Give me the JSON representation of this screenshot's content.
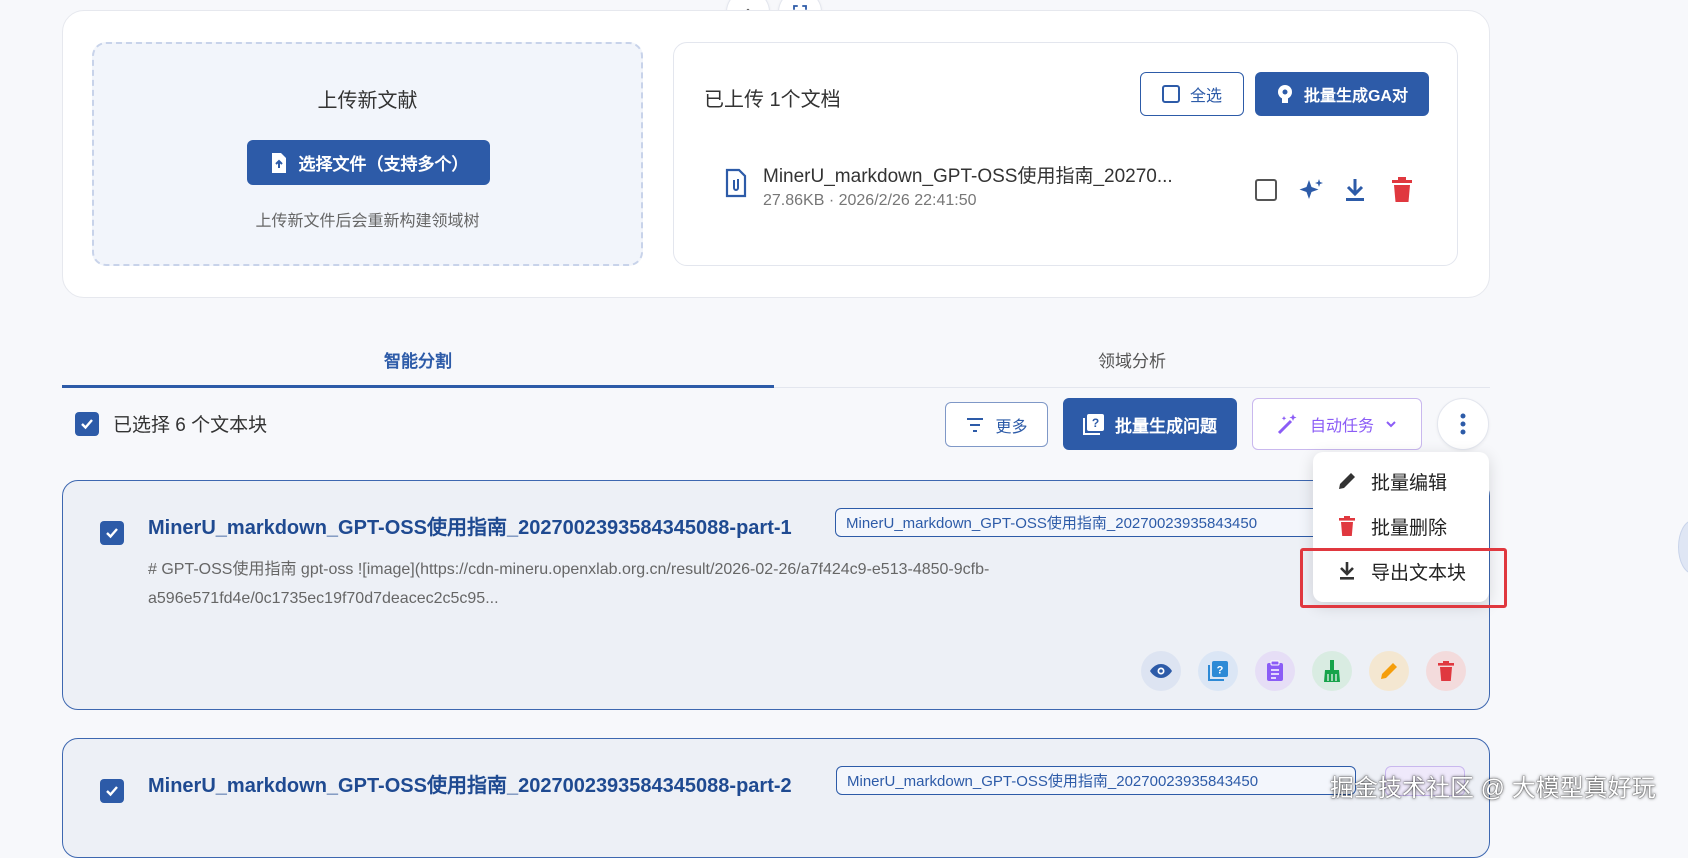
{
  "upload": {
    "title": "上传新文献",
    "choose_button": "选择文件（支持多个）",
    "hint": "上传新文件后会重新构建领域树"
  },
  "documents": {
    "title": "已上传 1个文档",
    "select_all": "全选",
    "batch_ga": "批量生成GA对",
    "items": [
      {
        "name": "MinerU_markdown_GPT-OSS使用指南_20270...",
        "meta": "27.86KB · 2026/2/26 22:41:50"
      }
    ]
  },
  "tabs": [
    {
      "label": "智能分割",
      "active": true
    },
    {
      "label": "领域分析",
      "active": false
    }
  ],
  "toolbar": {
    "selected_text": "已选择 6 个文本块",
    "more": "更多",
    "batch_questions": "批量生成问题",
    "auto_tasks": "自动任务"
  },
  "menu": {
    "items": [
      {
        "label": "批量编辑",
        "icon": "pencil-icon"
      },
      {
        "label": "批量删除",
        "icon": "trash-icon"
      },
      {
        "label": "导出文本块",
        "icon": "download-icon"
      }
    ]
  },
  "chunks": [
    {
      "title": "MinerU_markdown_GPT-OSS使用指南_2027002393584345088-part-1",
      "tag": "MinerU_markdown_GPT-OSS使用指南_20270023935843450",
      "line1": "# GPT-OSS使用指南 gpt-oss ![image](https://cdn-mineru.openxlab.org.cn/result/2026-02-26/a7f424c9-e513-4850-9cfb-",
      "line2": "a596e571fd4e/0c1735ec19f70d7deacec2c5c95..."
    },
    {
      "title": "MinerU_markdown_GPT-OSS使用指南_2027002393584345088-part-2",
      "tag": "MinerU_markdown_GPT-OSS使用指南_20270023935843450"
    }
  ],
  "watermark": "掘金技术社区 @ 大模型真好玩",
  "colors": {
    "primary": "#2d5ba8",
    "danger": "#e0383f",
    "purple": "#8b5cf6",
    "green": "#16a34a",
    "orange": "#f59e0b"
  }
}
